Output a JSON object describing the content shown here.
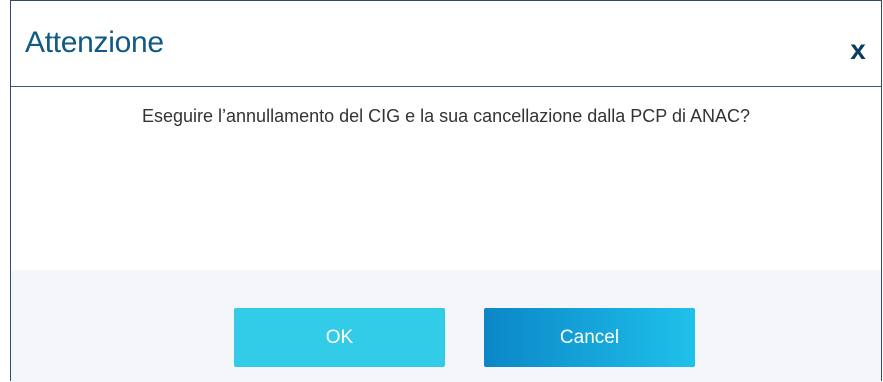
{
  "dialog": {
    "title": "Attenzione",
    "close_symbol": "x",
    "message": "Eseguire l’annullamento del CIG e la sua cancellazione dalla PCP di ANAC?",
    "buttons": {
      "ok_label": "OK",
      "cancel_label": "Cancel"
    }
  },
  "colors": {
    "title": "#0f5a86",
    "ok_button": "#32cbe8",
    "cancel_button_start": "#0b86c7",
    "cancel_button_end": "#1fc1ea",
    "footer_background": "#f4f6f9",
    "border": "#2b4d6b"
  },
  "icons": {
    "close": "close-icon"
  }
}
